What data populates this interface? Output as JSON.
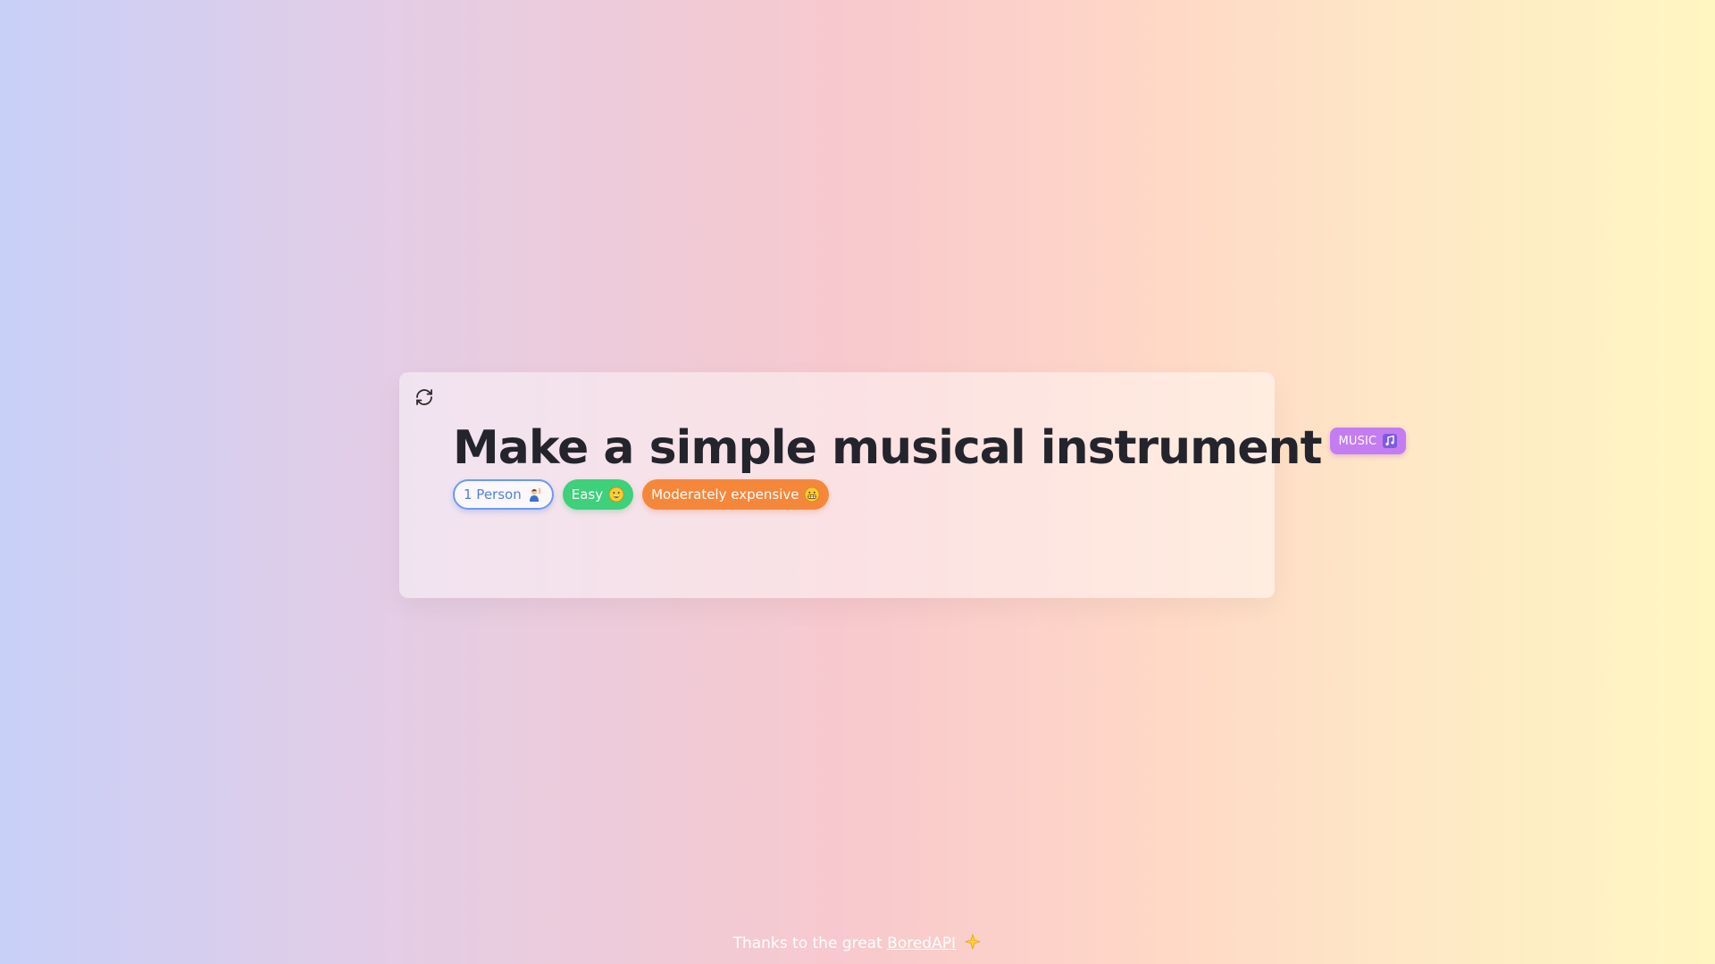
{
  "activity": {
    "title": "Make a simple musical instrument",
    "type_label": "MUSIC",
    "type_icon": "music-note-icon",
    "participants_label": "1 Person",
    "participants_icon": "person-raising-hand-icon",
    "difficulty_label": "Easy",
    "difficulty_icon": "grinning-face-icon",
    "price_label": "Moderately expensive",
    "price_icon": "grimacing-face-icon"
  },
  "refresh_icon": "refresh-icon",
  "footer": {
    "prefix": "Thanks to the great",
    "link_text": "BoredAPI",
    "icon": "sparkles-icon"
  },
  "colors": {
    "title": "#24242c",
    "type_badge": "#c47df0",
    "participants": "#6a9bf2",
    "difficulty": "#3ed07a",
    "price": "#f5873b"
  }
}
